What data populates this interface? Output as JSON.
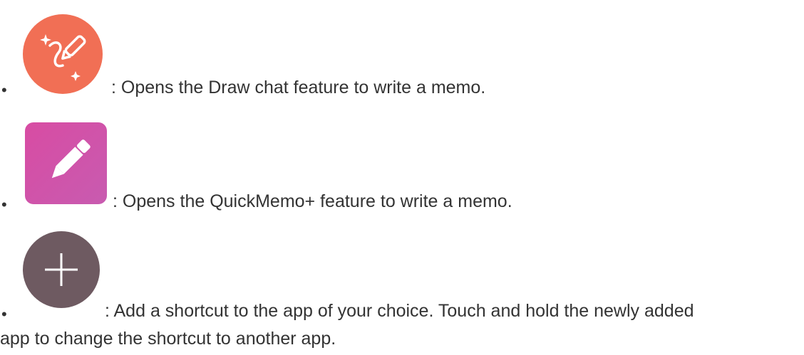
{
  "items": [
    {
      "icon": "draw-chat-icon",
      "icon_color": "#F16F55",
      "text": ": Opens the Draw chat feature to write a memo."
    },
    {
      "icon": "quickmemo-pencil-icon",
      "icon_color": "#D657A8",
      "text": ": Opens the QuickMemo+ feature to write a memo."
    },
    {
      "icon": "add-plus-icon",
      "icon_color": "#6E5A61",
      "text_line1": ": Add a shortcut to the app of your choice. Touch and hold the newly added",
      "text_line2": "app to change the shortcut to another app."
    }
  ],
  "bullet_char": "•"
}
